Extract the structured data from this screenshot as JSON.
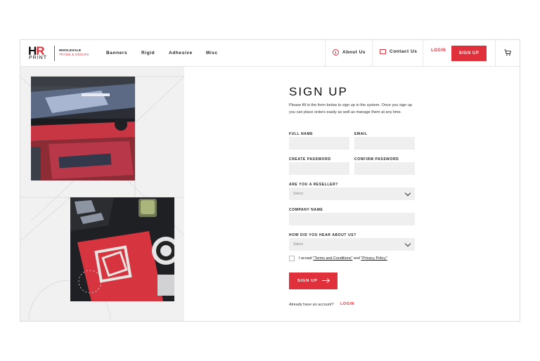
{
  "header": {
    "logo_hr": "HR",
    "logo_print": "PRINT",
    "tagline_1": "WHOLESALE",
    "tagline_2": "TRADE & DESIGN",
    "nav": [
      "Banners",
      "Rigid",
      "Adhesive",
      "Misc"
    ],
    "about": "About Us",
    "contact": "Contact Us",
    "login": "LOGIN",
    "signup": "SIGN UP"
  },
  "form": {
    "title": "SIGN UP",
    "intro": "Please fill in the form below to sign up in the system. Once you sign up you can place orders easily as well as manage them at any time.",
    "full_name_label": "FULL NAME",
    "email_label": "EMAIL",
    "create_password_label": "CREATE PASSWORD",
    "confirm_password_label": "CONFIRM PASSWORD",
    "reseller_label": "ARE YOU A RESELLER?",
    "reseller_value": "Select",
    "company_label": "COMPANY NAME",
    "hear_label": "HOW DID YOU HEAR ABOUT US?",
    "hear_value": "Select",
    "terms_prefix": "I accept ",
    "terms_link": "\"Terms and Conditions\"",
    "terms_and": " and ",
    "privacy_link": "\"Privacy Policy\"",
    "submit": "SIGN UP",
    "already": "Already have an account?",
    "login_link": "LOGIN"
  },
  "colors": {
    "accent": "#e0303b",
    "input_bg": "#efefef",
    "panel_bg": "#f1f1f1"
  }
}
